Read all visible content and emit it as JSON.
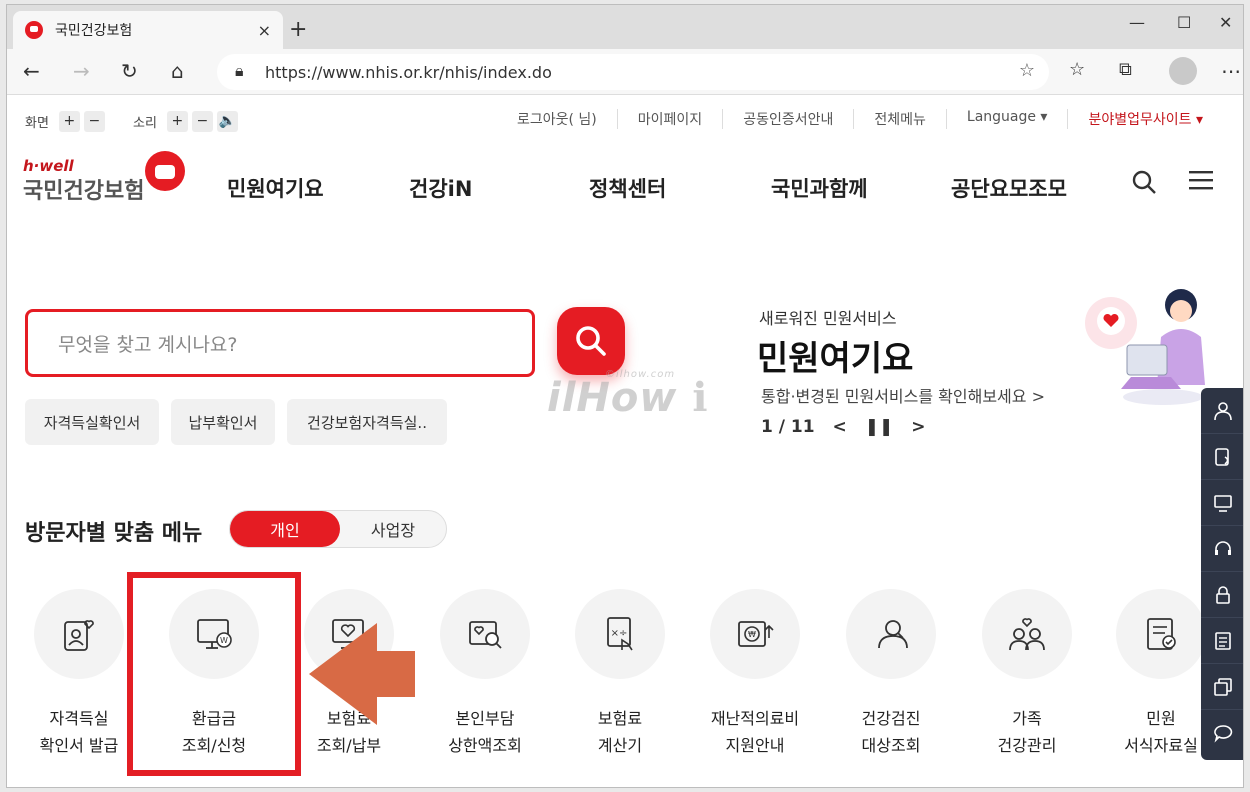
{
  "browser": {
    "tab_title": "국민건강보험",
    "tab_close": "×",
    "new_tab": "+",
    "url": "https://www.nhis.or.kr/nhis/index.do",
    "win_minimize": "—",
    "win_maximize": "☐",
    "win_close": "✕",
    "nav_back": "←",
    "nav_forward": "→",
    "nav_refresh": "↻",
    "nav_home": "⌂",
    "more": "⋯"
  },
  "utility": {
    "screen_label": "화면",
    "sound_label": "소리",
    "plus": "+",
    "minus": "−",
    "speaker": "🔈"
  },
  "top_links": {
    "logout": "로그아웃(     님)",
    "mypage": "마이페이지",
    "cert": "공동인증서안내",
    "allmenu": "전체메뉴",
    "language": "Language ▾",
    "sites": "분야별업무사이트 ▾"
  },
  "logo": {
    "hwell": "h·well",
    "name": "국민건강보험"
  },
  "gnb": [
    "민원여기요",
    "건강iN",
    "정책센터",
    "국민과함께",
    "공단요모조모"
  ],
  "search": {
    "placeholder": "무엇을 찾고 계시나요?"
  },
  "quick_chips": [
    "자격득실확인서",
    "납부확인서",
    "건강보험자격득실.."
  ],
  "watermark": {
    "main": "ilHow",
    "small": "©ilhow.com",
    "mark": "ℹ"
  },
  "promo": {
    "sub": "새로워진 민원서비스",
    "title": "민원여기요",
    "desc": "통합·변경된 민원서비스를 확인해보세요 >",
    "page": "1 / 11",
    "prev": "<",
    "pause": "❚❚",
    "next": ">"
  },
  "visitor_menu": {
    "title": "방문자별 맞춤 메뉴",
    "toggle_on": "개인",
    "toggle_off": "사업장",
    "items": [
      {
        "line1": "자격득실",
        "line2": "확인서 발급"
      },
      {
        "line1": "환급금",
        "line2": "조회/신청"
      },
      {
        "line1": "보험료",
        "line2": "조회/납부"
      },
      {
        "line1": "본인부담",
        "line2": "상한액조회"
      },
      {
        "line1": "보험료",
        "line2": "계산기"
      },
      {
        "line1": "재난적의료비",
        "line2": "지원안내"
      },
      {
        "line1": "건강검진",
        "line2": "대상조회"
      },
      {
        "line1": "가족",
        "line2": "건강관리"
      },
      {
        "line1": "민원",
        "line2": "서식자료실"
      }
    ]
  },
  "colors": {
    "brand_red": "#e51c23",
    "annotation_red": "#e31e24",
    "arrow": "#d86a45",
    "quickbar": "#2d3444"
  }
}
